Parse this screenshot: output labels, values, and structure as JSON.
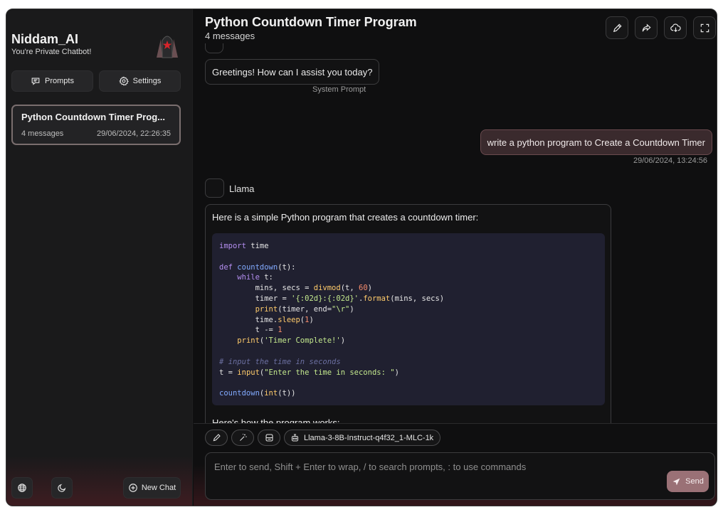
{
  "sidebar": {
    "brand_title": "Niddam_AI",
    "brand_subtitle": "You're Private Chatbot!",
    "prompts_label": "Prompts",
    "settings_label": "Settings",
    "chats": [
      {
        "title": "Python Countdown Timer Prog...",
        "messages": "4 messages",
        "date": "29/06/2024, 22:26:35"
      }
    ],
    "new_chat_label": "New Chat"
  },
  "header": {
    "title": "Python Countdown Timer Program",
    "subtitle": "4 messages"
  },
  "messages": {
    "system_text": "Greetings! How can I assist you today?",
    "system_label": "System Prompt",
    "user_text": "write a python program to Create a Countdown Timer",
    "user_time": "29/06/2024, 13:24:56",
    "assistant_name": "Llama",
    "assistant_intro": "Here is a simple Python program that creates a countdown timer:",
    "code": [
      "import time",
      "",
      "def countdown(t):",
      "    while t:",
      "        mins, secs = divmod(t, 60)",
      "        timer = '{:02d}:{:02d}'.format(mins, secs)",
      "        print(timer, end=\"\\r\")",
      "        time.sleep(1)",
      "        t -= 1",
      "    print('Timer Complete!')",
      "",
      "# input the time in seconds",
      "t = input(\"Enter the time in seconds: \")",
      "",
      "countdown(int(t))"
    ],
    "assistant_outro": "Here's how the program works:"
  },
  "composer": {
    "model": "Llama-3-8B-Instruct-q4f32_1-MLC-1k",
    "placeholder": "Enter to send, Shift + Enter to wrap, / to search prompts, : to use commands",
    "value": "",
    "send_label": "Send"
  },
  "colors": {
    "background": "#0f0f10",
    "sidebar": "#1a1a1b",
    "accent": "#9a7176",
    "user_bubble": "#3a2a2d",
    "code_bg": "#202030"
  },
  "icons": [
    "prompts-icon",
    "settings-icon",
    "edit-icon",
    "share-icon",
    "download-icon",
    "fullscreen-icon",
    "globe-icon",
    "moon-icon",
    "plus-circle-icon",
    "chevrons-down-icon",
    "pencil-icon",
    "magic-wand-icon",
    "layout-icon",
    "robot-icon",
    "send-icon"
  ]
}
